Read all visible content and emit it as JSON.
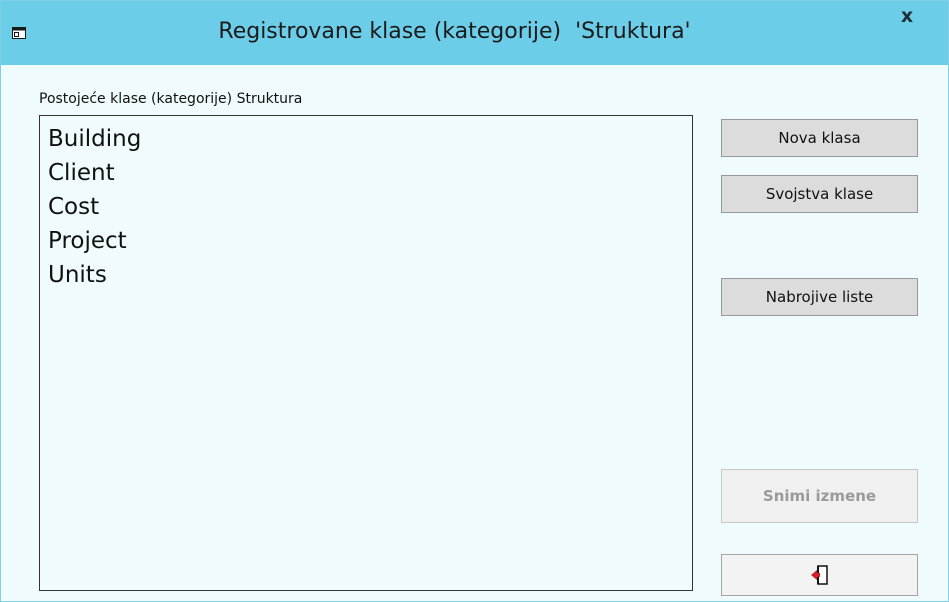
{
  "window": {
    "title": "Registrovane klase (kategorije)  'Struktura'",
    "close_label": "x",
    "accent_color": "#6ccde8"
  },
  "classes_panel": {
    "label": "Postojeće klase (kategorije) Struktura",
    "items": [
      "Building",
      "Client",
      "Cost",
      "Project",
      "Units"
    ]
  },
  "buttons": {
    "new_class": "Nova klasa",
    "class_properties": "Svojstva klase",
    "enumerated_lists": "Nabrojive liste",
    "save_changes": "Snimi izmene",
    "exit_icon": "exit-door-icon"
  }
}
